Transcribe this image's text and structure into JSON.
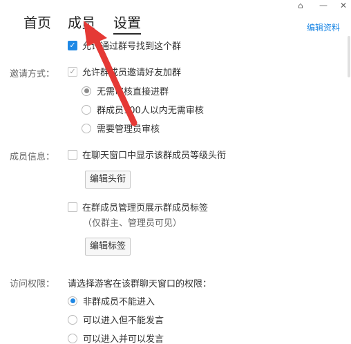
{
  "window": {
    "controls": [
      {
        "name": "skin-icon",
        "glyph": "⌂"
      },
      {
        "name": "minimize-icon",
        "glyph": "—"
      },
      {
        "name": "close-icon",
        "glyph": "✕"
      }
    ]
  },
  "tabs": [
    {
      "label": "首页",
      "active": false
    },
    {
      "label": "成员",
      "active": false
    },
    {
      "label": "设置",
      "active": true
    }
  ],
  "header": {
    "edit_link": "编辑资料"
  },
  "search": {
    "checkbox_label": "允许通过群号找到这个群",
    "checked": true
  },
  "invite": {
    "label": "邀请方式：",
    "allow_label": "允许群成员邀请好友加群",
    "allow_checked": true,
    "options": [
      {
        "label": "无需审核直接进群",
        "selected": true
      },
      {
        "label": "群成员100人以内无需审核",
        "selected": false
      },
      {
        "label": "需要管理员审核",
        "selected": false
      }
    ]
  },
  "member_info": {
    "label": "成员信息：",
    "show_level_label": "在聊天窗口中显示该群成员等级头衔",
    "show_level_checked": false,
    "edit_title_button": "编辑头衔",
    "show_tag_label": "在群成员管理页展示群成员标签",
    "show_tag_checked": false,
    "tag_hint": "（仅群主、管理员可见）",
    "edit_tag_button": "编辑标签"
  },
  "access": {
    "label": "访问权限：",
    "prompt": "请选择游客在该群聊天窗口的权限：",
    "options": [
      {
        "label": "非群成员不能进入",
        "selected": true
      },
      {
        "label": "可以进入但不能发言",
        "selected": false
      },
      {
        "label": "可以进入并可以发言",
        "selected": false
      }
    ]
  },
  "colors": {
    "accent": "#1e88e5",
    "annotation_arrow": "#e53935"
  }
}
